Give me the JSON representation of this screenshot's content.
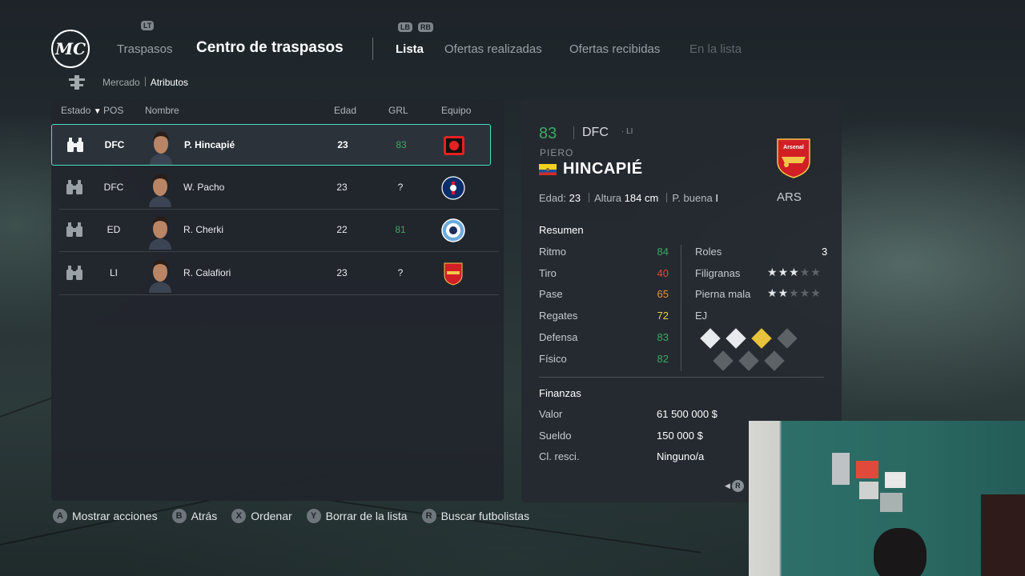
{
  "header": {
    "logo_text": "MC",
    "lt_hint": "LT",
    "lb_hint": "LB",
    "rb_hint": "RB",
    "section_link": "Traspasos",
    "title": "Centro de traspasos",
    "tabs": [
      {
        "label": "Lista",
        "state": "active"
      },
      {
        "label": "Ofertas realizadas",
        "state": "normal"
      },
      {
        "label": "Ofertas recibidas",
        "state": "normal"
      },
      {
        "label": "En la lista",
        "state": "disabled"
      }
    ]
  },
  "subnav": {
    "market": "Mercado",
    "attributes": "Atributos"
  },
  "table": {
    "headers": {
      "estado": "Estado",
      "pos": "POS",
      "nombre": "Nombre",
      "edad": "Edad",
      "grl": "GRL",
      "equipo": "Equipo"
    },
    "rows": [
      {
        "pos": "DFC",
        "name": "P. Hincapié",
        "age": "23",
        "grl": "83",
        "grl_color": "#3fa863",
        "club": "leverkusen",
        "selected": true
      },
      {
        "pos": "DFC",
        "name": "W. Pacho",
        "age": "23",
        "grl": "?",
        "grl_color": "#e9ecef",
        "club": "psg",
        "selected": false
      },
      {
        "pos": "ED",
        "name": "R. Cherki",
        "age": "22",
        "grl": "81",
        "grl_color": "#3fa863",
        "club": "man-city",
        "selected": false
      },
      {
        "pos": "LI",
        "name": "R. Calafiori",
        "age": "23",
        "grl": "?",
        "grl_color": "#e9ecef",
        "club": "arsenal",
        "selected": false
      }
    ]
  },
  "detail": {
    "rating": "83",
    "position": "DFC",
    "alt_position": "· LI",
    "first_name": "PIERO",
    "last_name": "HINCAPIÉ",
    "age_label": "Edad:",
    "age": "23",
    "height_label": "Altura",
    "height": "184 cm",
    "foot_label": "P. buena",
    "foot": "I",
    "club_abbr": "ARS",
    "club_crest_text": "Arsenal",
    "summary_title": "Resumen",
    "stats": [
      {
        "label": "Ritmo",
        "value": "84",
        "color": "#3fa863"
      },
      {
        "label": "Tiro",
        "value": "40",
        "color": "#e2483c"
      },
      {
        "label": "Pase",
        "value": "65",
        "color": "#e8943a"
      },
      {
        "label": "Regates",
        "value": "72",
        "color": "#e8d23a"
      },
      {
        "label": "Defensa",
        "value": "83",
        "color": "#3fa863"
      },
      {
        "label": "Físico",
        "value": "82",
        "color": "#3fa863"
      }
    ],
    "roles_label": "Roles",
    "roles_value": "3",
    "skill_label": "Filigranas",
    "skill_stars": 3,
    "weak_label": "Pierna mala",
    "weak_stars": 2,
    "ej_label": "EJ",
    "finance_title": "Finanzas",
    "finances": [
      {
        "label": "Valor",
        "value": "61 500 000 $"
      },
      {
        "label": "Sueldo",
        "value": "150 000 $"
      },
      {
        "label": "Cl. resci.",
        "value": "Ninguno/a"
      }
    ],
    "r_hint": "R"
  },
  "footer": [
    {
      "btn": "A",
      "label": "Mostrar acciones"
    },
    {
      "btn": "B",
      "label": "Atrás"
    },
    {
      "btn": "X",
      "label": "Ordenar"
    },
    {
      "btn": "Y",
      "label": "Borrar de la lista"
    },
    {
      "btn": "R",
      "label": "Buscar futbolistas"
    }
  ]
}
